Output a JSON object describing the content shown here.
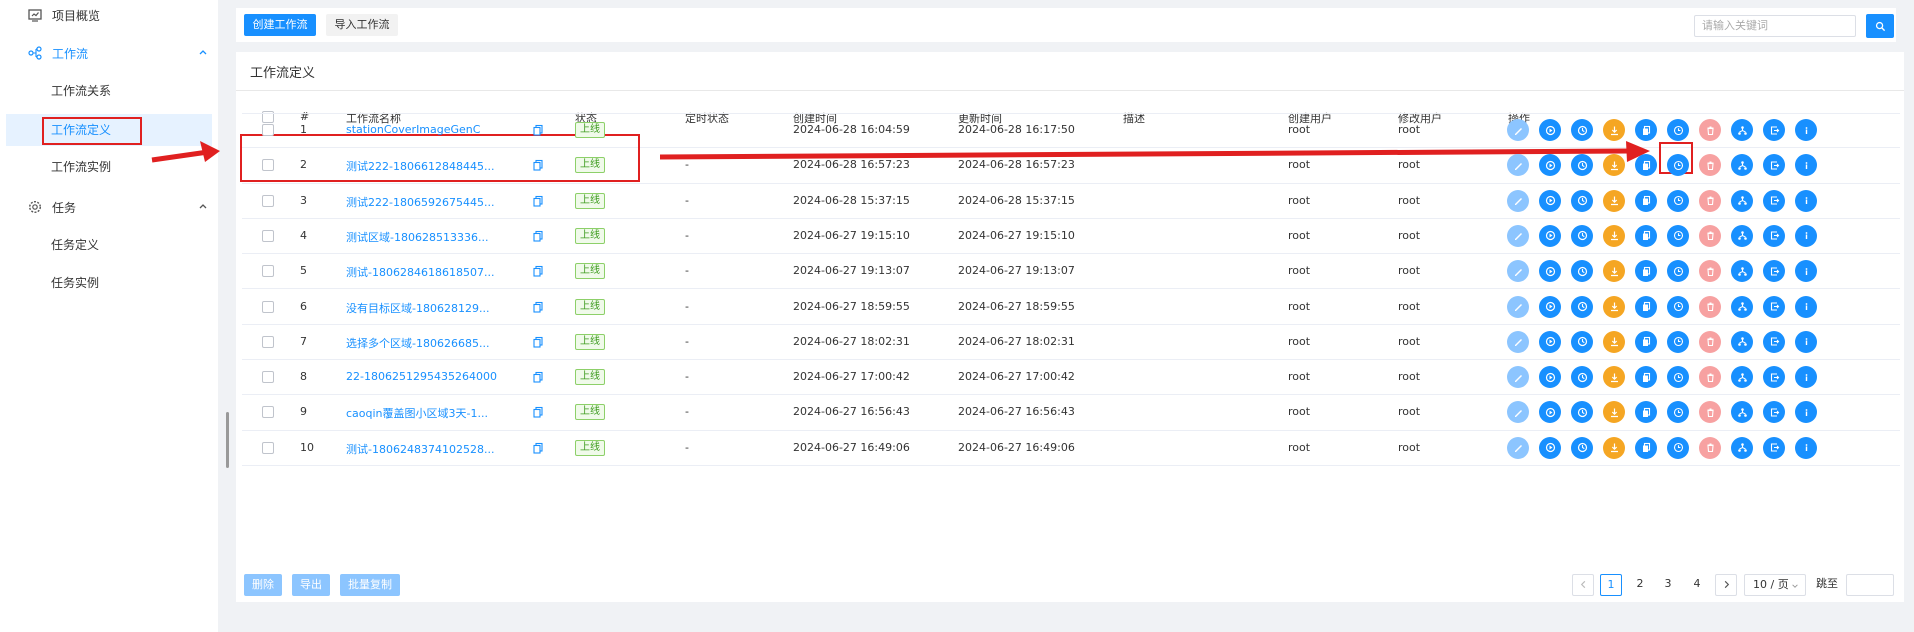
{
  "sidebar": {
    "items": [
      {
        "label": "项目概览",
        "icon": "dashboard-icon"
      },
      {
        "label": "工作流",
        "icon": "workflow-icon",
        "expanded": true,
        "children": [
          "工作流关系",
          "工作流定义",
          "工作流实例"
        ]
      },
      {
        "label": "任务",
        "icon": "gear-icon",
        "expanded": true,
        "children": [
          "任务定义",
          "任务实例"
        ]
      }
    ],
    "active_child": "工作流定义"
  },
  "toolbar": {
    "create_label": "创建工作流",
    "import_label": "导入工作流",
    "search_placeholder": "请输入关键词"
  },
  "panel": {
    "title": "工作流定义"
  },
  "table": {
    "headers": [
      "#",
      "工作流名称",
      "状态",
      "定时状态",
      "创建时间",
      "更新时间",
      "描述",
      "创建用户",
      "修改用户",
      "操作"
    ],
    "rows": [
      {
        "no": "1",
        "name": "stationCoverImageGenC",
        "status": "上线",
        "timing": "",
        "created": "2024-06-28 16:04:59",
        "updated": "2024-06-28 16:17:50",
        "desc": "",
        "creator": "root",
        "modifier": "root"
      },
      {
        "no": "2",
        "name": "测试222-1806612848445...",
        "status": "上线",
        "timing": "-",
        "created": "2024-06-28 16:57:23",
        "updated": "2024-06-28 16:57:23",
        "desc": "",
        "creator": "root",
        "modifier": "root"
      },
      {
        "no": "3",
        "name": "测试222-1806592675445...",
        "status": "上线",
        "timing": "-",
        "created": "2024-06-28 15:37:15",
        "updated": "2024-06-28 15:37:15",
        "desc": "",
        "creator": "root",
        "modifier": "root"
      },
      {
        "no": "4",
        "name": "测试区域-180628513336...",
        "status": "上线",
        "timing": "-",
        "created": "2024-06-27 19:15:10",
        "updated": "2024-06-27 19:15:10",
        "desc": "",
        "creator": "root",
        "modifier": "root"
      },
      {
        "no": "5",
        "name": "测试-1806284618618507...",
        "status": "上线",
        "timing": "-",
        "created": "2024-06-27 19:13:07",
        "updated": "2024-06-27 19:13:07",
        "desc": "",
        "creator": "root",
        "modifier": "root"
      },
      {
        "no": "6",
        "name": "没有目标区域-180628129...",
        "status": "上线",
        "timing": "-",
        "created": "2024-06-27 18:59:55",
        "updated": "2024-06-27 18:59:55",
        "desc": "",
        "creator": "root",
        "modifier": "root"
      },
      {
        "no": "7",
        "name": "选择多个区域-180626685...",
        "status": "上线",
        "timing": "-",
        "created": "2024-06-27 18:02:31",
        "updated": "2024-06-27 18:02:31",
        "desc": "",
        "creator": "root",
        "modifier": "root"
      },
      {
        "no": "8",
        "name": "22-1806251295435264000",
        "status": "上线",
        "timing": "-",
        "created": "2024-06-27 17:00:42",
        "updated": "2024-06-27 17:00:42",
        "desc": "",
        "creator": "root",
        "modifier": "root"
      },
      {
        "no": "9",
        "name": "caoqin覆盖图小区域3天-1...",
        "status": "上线",
        "timing": "-",
        "created": "2024-06-27 16:56:43",
        "updated": "2024-06-27 16:56:43",
        "desc": "",
        "creator": "root",
        "modifier": "root"
      },
      {
        "no": "10",
        "name": "测试-1806248374102528...",
        "status": "上线",
        "timing": "-",
        "created": "2024-06-27 16:49:06",
        "updated": "2024-06-27 16:49:06",
        "desc": "",
        "creator": "root",
        "modifier": "root"
      }
    ],
    "operations": [
      {
        "name": "edit-icon",
        "color": "#8cc5ff"
      },
      {
        "name": "run-icon",
        "color": "#1890ff"
      },
      {
        "name": "timing-icon",
        "color": "#1890ff"
      },
      {
        "name": "download-icon",
        "color": "#f5a623"
      },
      {
        "name": "copy-icon",
        "color": "#1890ff"
      },
      {
        "name": "schedule-icon",
        "color": "#1890ff"
      },
      {
        "name": "delete-icon",
        "color": "#f7a1a1"
      },
      {
        "name": "tree-icon",
        "color": "#1890ff"
      },
      {
        "name": "export-icon",
        "color": "#1890ff"
      },
      {
        "name": "info-icon",
        "color": "#1890ff"
      }
    ]
  },
  "footer": {
    "delete_label": "删除",
    "export_label": "导出",
    "batch_copy_label": "批量复制",
    "pages": [
      "1",
      "2",
      "3",
      "4"
    ],
    "current_page": "1",
    "page_size": "10 / 页",
    "jump_label": "跳至"
  },
  "colors": {
    "primary": "#1890ff",
    "online_tag": "#3d9b1e",
    "annotation": "#e02020"
  }
}
